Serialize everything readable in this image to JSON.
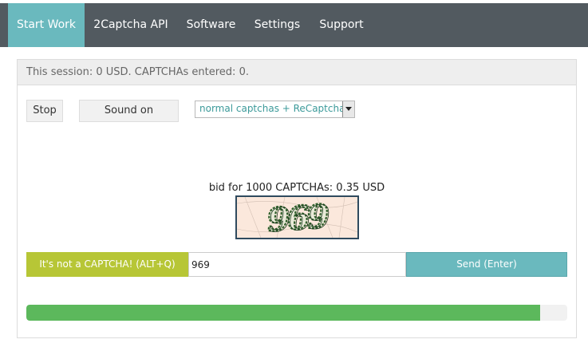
{
  "nav": {
    "items": [
      {
        "label": "Start Work",
        "active": true
      },
      {
        "label": "2Captcha API",
        "active": false
      },
      {
        "label": "Software",
        "active": false
      },
      {
        "label": "Settings",
        "active": false
      },
      {
        "label": "Support",
        "active": false
      }
    ]
  },
  "session": {
    "text": "This session: 0 USD. CAPTCHAs entered: 0."
  },
  "controls": {
    "stop_label": "Stop",
    "sound_label": "Sound on",
    "mode_select": {
      "selected": "normal captchas + ReCaptcha"
    }
  },
  "captcha": {
    "bid_text": "bid for 1000 CAPTCHAs: 0.35 USD",
    "image_text": "969"
  },
  "answer": {
    "not_captcha_label": "It's not a CAPTCHA! (ALT+Q)",
    "input_value": "969",
    "send_label": "Send (Enter)"
  },
  "progress": {
    "fraction": 0.95
  },
  "colors": {
    "navbar": "#525a60",
    "accent": "#6ab9be",
    "not_captcha": "#b7c636",
    "progress": "#5cb85c",
    "captcha_bg": "#fbe8dc",
    "captcha_ink": "#2f5e2a"
  }
}
